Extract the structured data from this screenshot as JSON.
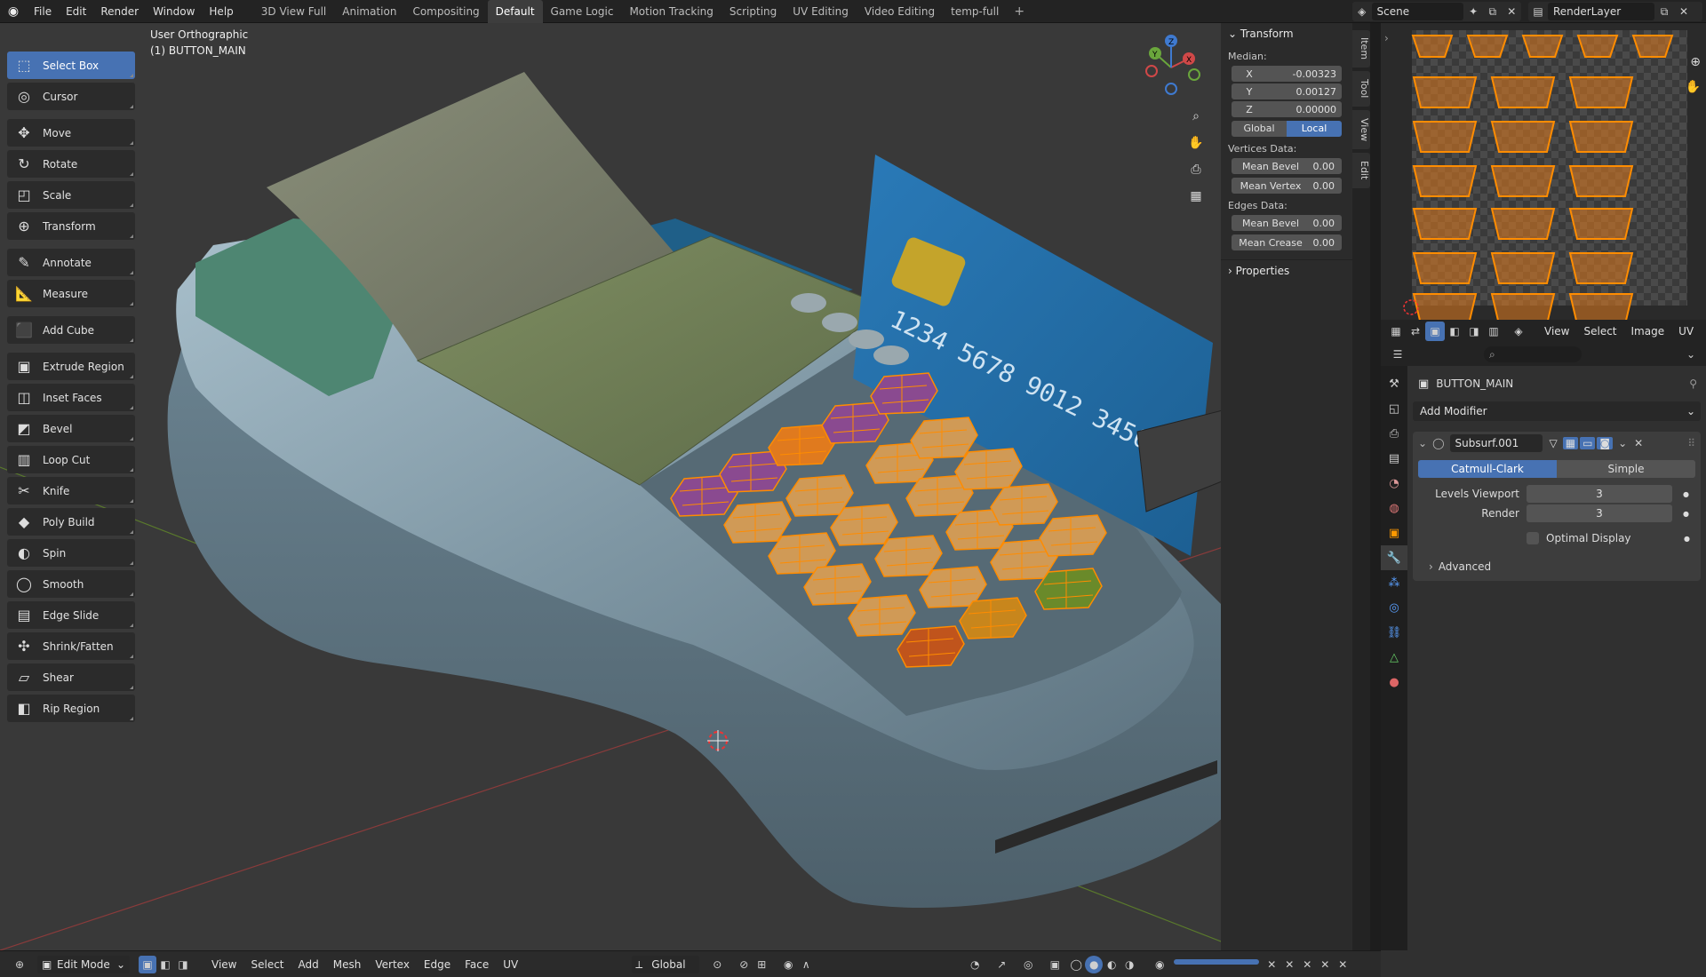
{
  "topbar": {
    "menus": [
      "File",
      "Edit",
      "Render",
      "Window",
      "Help"
    ],
    "workspaces": [
      "3D View Full",
      "Animation",
      "Compositing",
      "Default",
      "Game Logic",
      "Motion Tracking",
      "Scripting",
      "UV Editing",
      "Video Editing",
      "temp-full"
    ],
    "active_workspace": "Default",
    "scene": "Scene",
    "view_layer": "RenderLayer"
  },
  "viewport": {
    "view_name": "User Orthographic",
    "object_label": "(1) BUTTON_MAIN",
    "card_number": "1234 5678 9012 3456"
  },
  "gizmo": {
    "x": "X",
    "y": "Y",
    "z": "Z"
  },
  "toolbar": {
    "tools": [
      {
        "label": "Select Box",
        "icon": "select-box-icon",
        "glyph": "⬚",
        "active": true
      },
      {
        "label": "Cursor",
        "icon": "cursor-icon",
        "glyph": "◎"
      },
      {
        "label": "Move",
        "icon": "move-icon",
        "glyph": "✥"
      },
      {
        "label": "Rotate",
        "icon": "rotate-icon",
        "glyph": "↻"
      },
      {
        "label": "Scale",
        "icon": "scale-icon",
        "glyph": "◰"
      },
      {
        "label": "Transform",
        "icon": "transform-icon",
        "glyph": "⊕"
      },
      {
        "label": "Annotate",
        "icon": "annotate-icon",
        "glyph": "✎"
      },
      {
        "label": "Measure",
        "icon": "measure-icon",
        "glyph": "📐"
      },
      {
        "label": "Add Cube",
        "icon": "add-cube-icon",
        "glyph": "⬛"
      },
      {
        "label": "Extrude Region",
        "icon": "extrude-region-icon",
        "glyph": "▣"
      },
      {
        "label": "Inset Faces",
        "icon": "inset-faces-icon",
        "glyph": "◫"
      },
      {
        "label": "Bevel",
        "icon": "bevel-icon",
        "glyph": "◩"
      },
      {
        "label": "Loop Cut",
        "icon": "loop-cut-icon",
        "glyph": "▥"
      },
      {
        "label": "Knife",
        "icon": "knife-icon",
        "glyph": "✂"
      },
      {
        "label": "Poly Build",
        "icon": "poly-build-icon",
        "glyph": "◆"
      },
      {
        "label": "Spin",
        "icon": "spin-icon",
        "glyph": "◐"
      },
      {
        "label": "Smooth",
        "icon": "smooth-icon",
        "glyph": "◯"
      },
      {
        "label": "Edge Slide",
        "icon": "edge-slide-icon",
        "glyph": "▤"
      },
      {
        "label": "Shrink/Fatten",
        "icon": "shrink-fatten-icon",
        "glyph": "✣"
      },
      {
        "label": "Shear",
        "icon": "shear-icon",
        "glyph": "▱"
      },
      {
        "label": "Rip Region",
        "icon": "rip-region-icon",
        "glyph": "◧"
      }
    ]
  },
  "npanel": {
    "header": "Transform",
    "median_label": "Median:",
    "x_label": "X",
    "x": "-0.00323",
    "y_label": "Y",
    "y": "0.00127",
    "z_label": "Z",
    "z": "0.00000",
    "global": "Global",
    "local": "Local",
    "vertices_data": "Vertices Data:",
    "mean_bevel_label": "Mean Bevel",
    "mean_bevel_v": "0.00",
    "mean_vertex_label": "Mean Vertex",
    "mean_vertex_v": "0.00",
    "edges_data": "Edges Data:",
    "edge_mean_bevel_label": "Mean Bevel",
    "edge_mean_bevel_v": "0.00",
    "mean_crease_label": "Mean Crease",
    "mean_crease_v": "0.00",
    "properties": "Properties",
    "tabs": [
      "Item",
      "Tool",
      "View",
      "Edit"
    ]
  },
  "uv_header": {
    "view": "View",
    "select": "Select",
    "image": "Image",
    "uv": "UV"
  },
  "properties": {
    "object_name": "BUTTON_MAIN",
    "add_modifier": "Add Modifier",
    "modifier_name": "Subsurf.001",
    "catmull": "Catmull-Clark",
    "simple": "Simple",
    "levels_viewport_label": "Levels Viewport",
    "levels_viewport": "3",
    "render_label": "Render",
    "render": "3",
    "optimal_display": "Optimal Display",
    "advanced": "Advanced"
  },
  "bottombar": {
    "mode": "Edit Mode",
    "menus": [
      "View",
      "Select",
      "Add",
      "Mesh",
      "Vertex",
      "Edge",
      "Face",
      "UV"
    ],
    "orientation": "Global"
  },
  "colors": {
    "accent": "#4772b3",
    "selected_edge": "#ff8c00",
    "header": "#232323",
    "panel": "#2b2b2b",
    "viewport": "#393939"
  }
}
